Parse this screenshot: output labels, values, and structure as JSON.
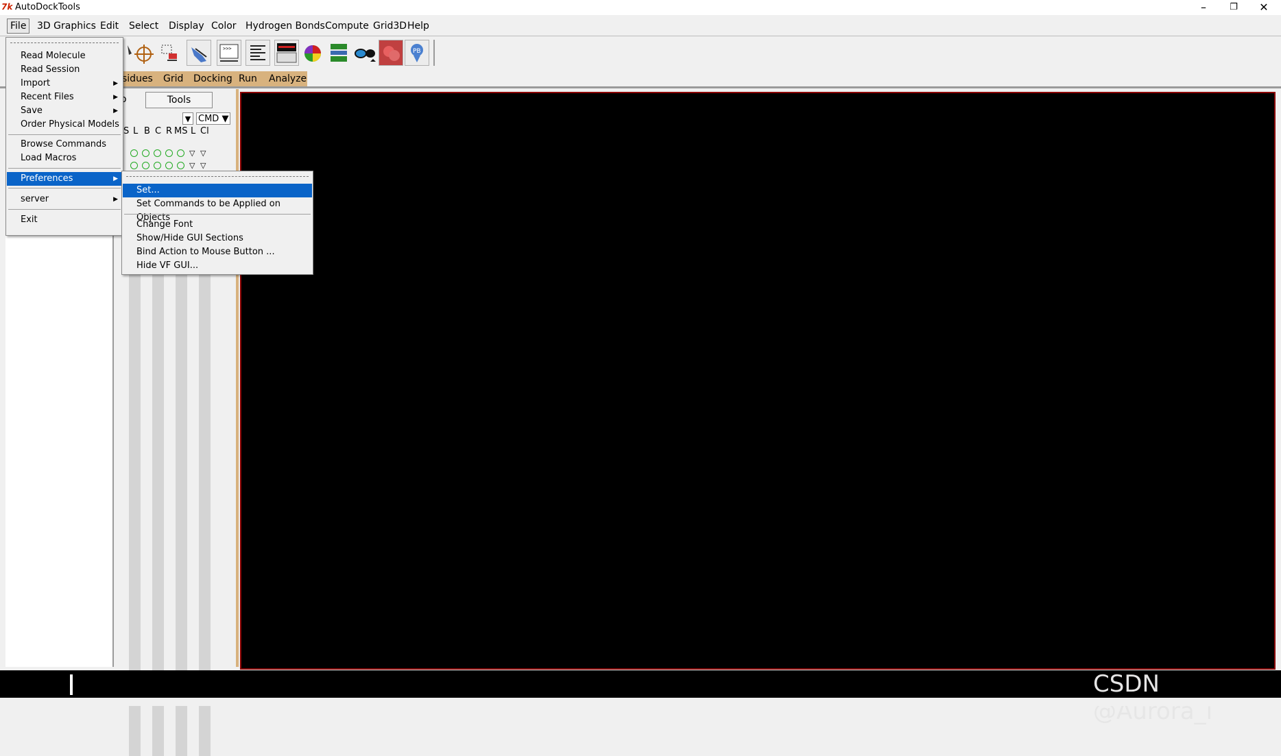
{
  "window": {
    "title": "AutoDockTools",
    "icon_glyph": "7k",
    "buttons": [
      "minimize-icon",
      "restore-icon",
      "close-icon"
    ]
  },
  "menubar": {
    "items": [
      "File",
      "3D Graphics",
      "Edit",
      "Select",
      "Display",
      "Color",
      "Hydrogen Bonds",
      "Compute",
      "Grid3D",
      "Help"
    ]
  },
  "adt_tabs": {
    "items": [
      "sidues",
      "Grid",
      "Docking",
      "Run",
      "Analyze"
    ]
  },
  "dashboard": {
    "tab_clipped": "o",
    "tools_label": "Tools",
    "cmd_label": "CMD",
    "columns": [
      "S",
      "L",
      "B",
      "C",
      "R",
      "MS",
      "L",
      "Cl"
    ]
  },
  "file_menu": {
    "items": [
      {
        "label": "Read Molecule",
        "submenu": false
      },
      {
        "label": "Read Session",
        "submenu": false
      },
      {
        "label": "Import",
        "submenu": true
      },
      {
        "label": "Recent Files",
        "submenu": true
      },
      {
        "label": "Save",
        "submenu": true
      },
      {
        "label": "Order Physical Models",
        "submenu": false
      },
      {
        "label": "Browse Commands",
        "submenu": false
      },
      {
        "label": "Load Macros",
        "submenu": false
      },
      {
        "label": "Preferences",
        "submenu": true,
        "selected": true
      },
      {
        "label": "server",
        "submenu": true
      },
      {
        "label": "Exit",
        "submenu": false
      }
    ]
  },
  "preferences_menu": {
    "items": [
      {
        "label": "Set...",
        "selected": true
      },
      {
        "label": "Set Commands to be Applied on Objects"
      },
      {
        "label": "Change Font"
      },
      {
        "label": "Show/Hide GUI Sections"
      },
      {
        "label": "Bind Action to Mouse Button ..."
      },
      {
        "label": "Hide VF GUI..."
      }
    ]
  },
  "watermark": "CSDN @Aurora_i",
  "colors": {
    "selection": "#0a64c8",
    "tab_bar": "#d8b27e",
    "viewer_bg": "#000000",
    "viewer_border": "#8b0000"
  }
}
